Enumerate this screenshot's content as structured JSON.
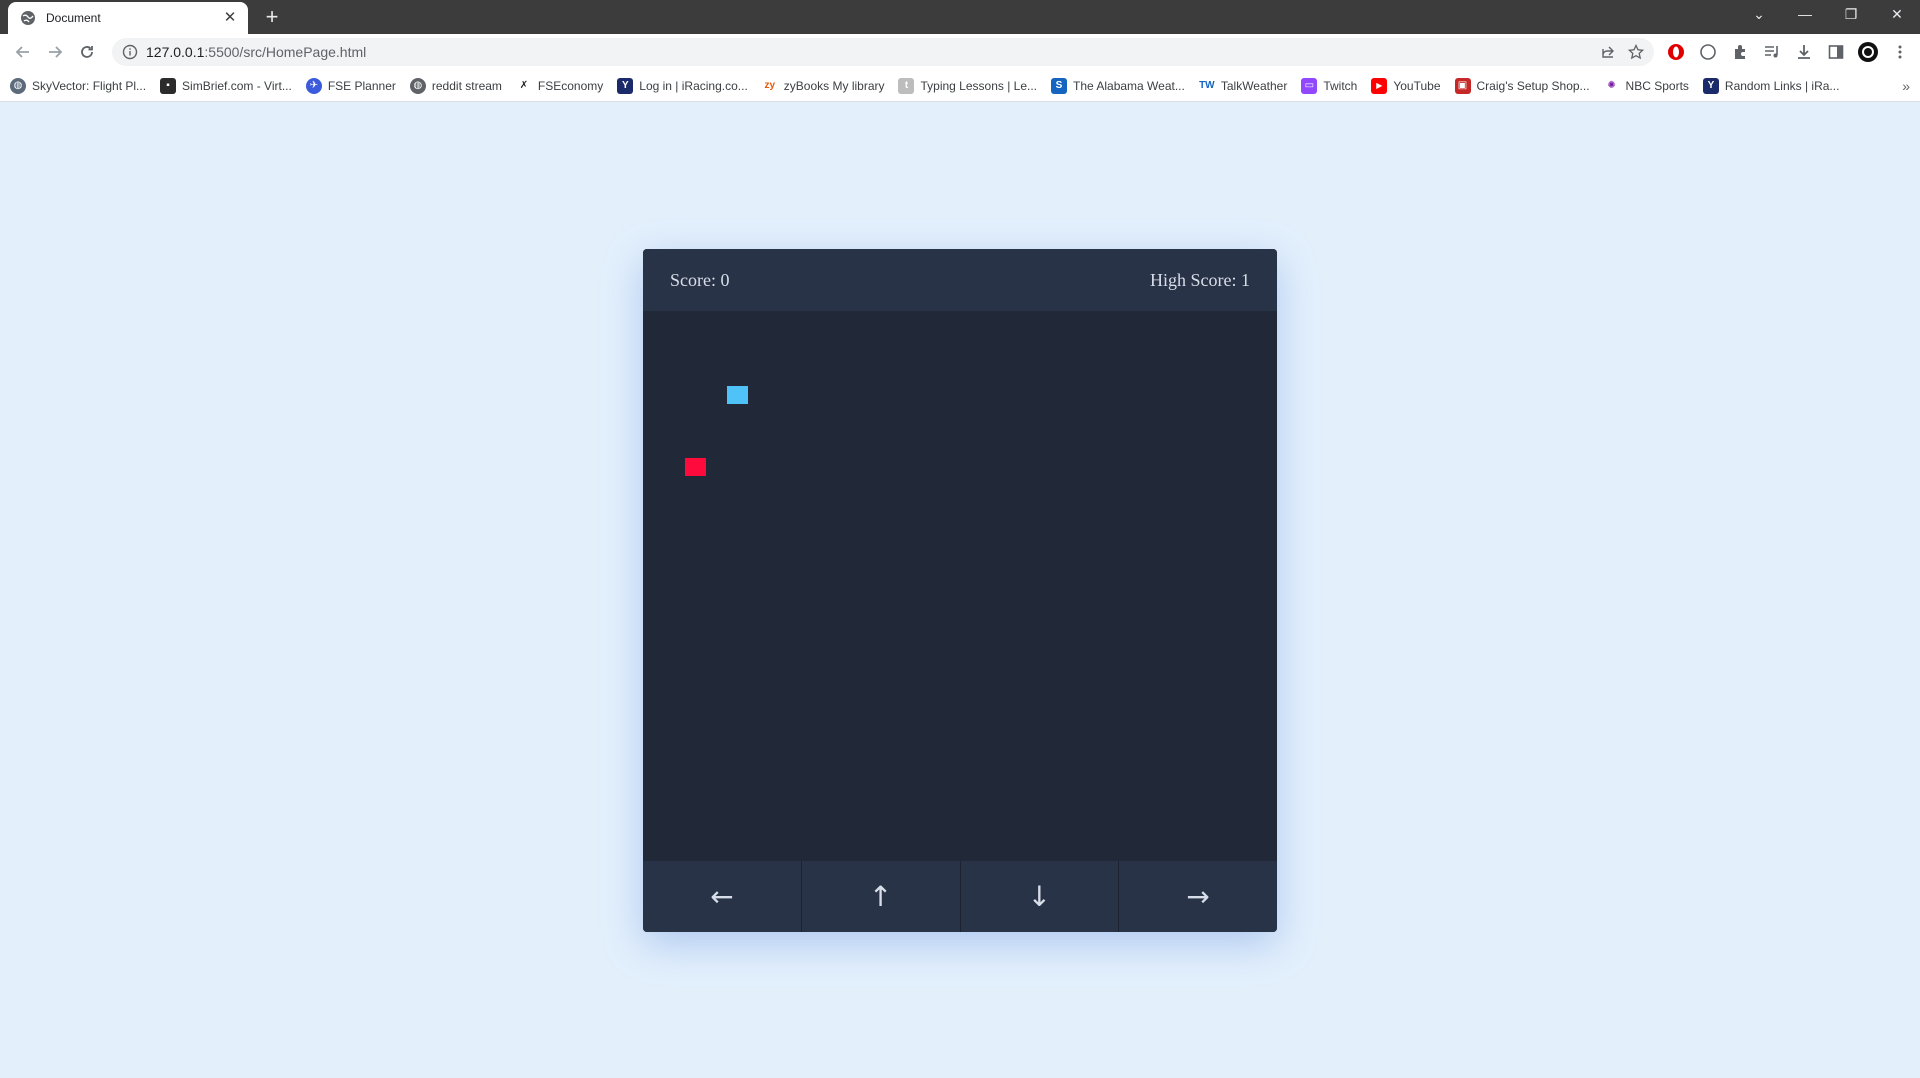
{
  "browser": {
    "tab_title": "Document",
    "new_tab_symbol": "+",
    "url_host": "127.0.0.1",
    "url_rest": ":5500/src/HomePage.html",
    "bookmarks": [
      {
        "label": "SkyVector: Flight Pl...",
        "icon": "globe-icon",
        "color": "#5b6b7c"
      },
      {
        "label": "SimBrief.com - Virt...",
        "icon": "simbrief-icon",
        "color": "#2b2b2b"
      },
      {
        "label": "FSE Planner",
        "icon": "plane-icon",
        "color": "#3b5bdb"
      },
      {
        "label": "reddit stream",
        "icon": "globe-icon",
        "color": "#5f6368"
      },
      {
        "label": "FSEconomy",
        "icon": "fseconomy-icon",
        "color": "#202124"
      },
      {
        "label": "Log in | iRacing.co...",
        "icon": "iracing-icon",
        "color": "#1b2a6b"
      },
      {
        "label": "zyBooks My library",
        "icon": "zybooks-icon",
        "color": "#e8590c"
      },
      {
        "label": "Typing Lessons | Le...",
        "icon": "typing-icon",
        "color": "#9e9e9e"
      },
      {
        "label": "The Alabama Weat...",
        "icon": "alabama-weather-icon",
        "color": "#1565c0"
      },
      {
        "label": "TalkWeather",
        "icon": "talkweather-icon",
        "color": "#1565c0"
      },
      {
        "label": "Twitch",
        "icon": "twitch-icon",
        "color": "#9146ff"
      },
      {
        "label": "YouTube",
        "icon": "youtube-icon",
        "color": "#ff0000"
      },
      {
        "label": "Craig's Setup Shop...",
        "icon": "setup-shop-icon",
        "color": "#c62828"
      },
      {
        "label": "NBC Sports",
        "icon": "nbc-icon",
        "color": "#7b1fa2"
      },
      {
        "label": "Random Links | iRa...",
        "icon": "iracing-icon",
        "color": "#1b2a6b"
      }
    ],
    "bookmarks_more": "»"
  },
  "game": {
    "score_text": "Score: 0",
    "high_score_text": "High Score: 1",
    "controls": [
      {
        "name": "left-arrow-button",
        "glyph": "←"
      },
      {
        "name": "up-arrow-button",
        "glyph": "↑"
      },
      {
        "name": "down-arrow-button",
        "glyph": "↓"
      },
      {
        "name": "right-arrow-button",
        "glyph": "→"
      }
    ],
    "colors": {
      "snake": "#4fc3f7",
      "food": "#ff0a3c",
      "board": "#212838",
      "panel": "#283347"
    }
  }
}
